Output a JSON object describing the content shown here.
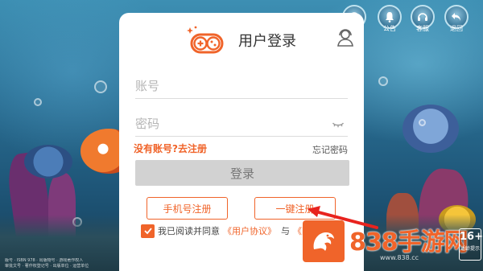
{
  "header": {
    "title": "用户登录",
    "logo_icon": "gamepad-icon",
    "service_icon": "customer-service-icon"
  },
  "top_buttons": [
    {
      "label": "公告",
      "icon": "bell-icon"
    },
    {
      "label": "客服",
      "icon": "headset-icon"
    },
    {
      "label": "退回",
      "icon": "back-arrow-icon"
    }
  ],
  "form": {
    "account_placeholder": "账号",
    "password_placeholder": "密码",
    "password_toggle_icon": "eye-hidden-icon",
    "no_account_link": "没有账号?去注册",
    "forgot_password_link": "忘记密码",
    "login_button": "登录",
    "phone_register_button": "手机号注册",
    "onekey_register_button": "一键注册"
  },
  "agreement": {
    "checked": true,
    "prefix": "我已阅读并同意",
    "user_agreement": "《用户协议》",
    "conjunction": "与",
    "privacy_partial": "《隐"
  },
  "watermark": {
    "text": "838手游网",
    "url": "www.838.cc",
    "age_rating": "16+",
    "age_tip": "适龄提示"
  },
  "fineprint": {
    "line1": "版号 · ISBN 978 · 出版物号 · 游戏著作权人",
    "line2": "审批文号 · 著作权登记号 · 出版单位 · 运营单位"
  },
  "colors": {
    "accent": "#f0642a",
    "login_button_bg": "#d2d2d2",
    "dialog_bg": "#ffffff"
  }
}
